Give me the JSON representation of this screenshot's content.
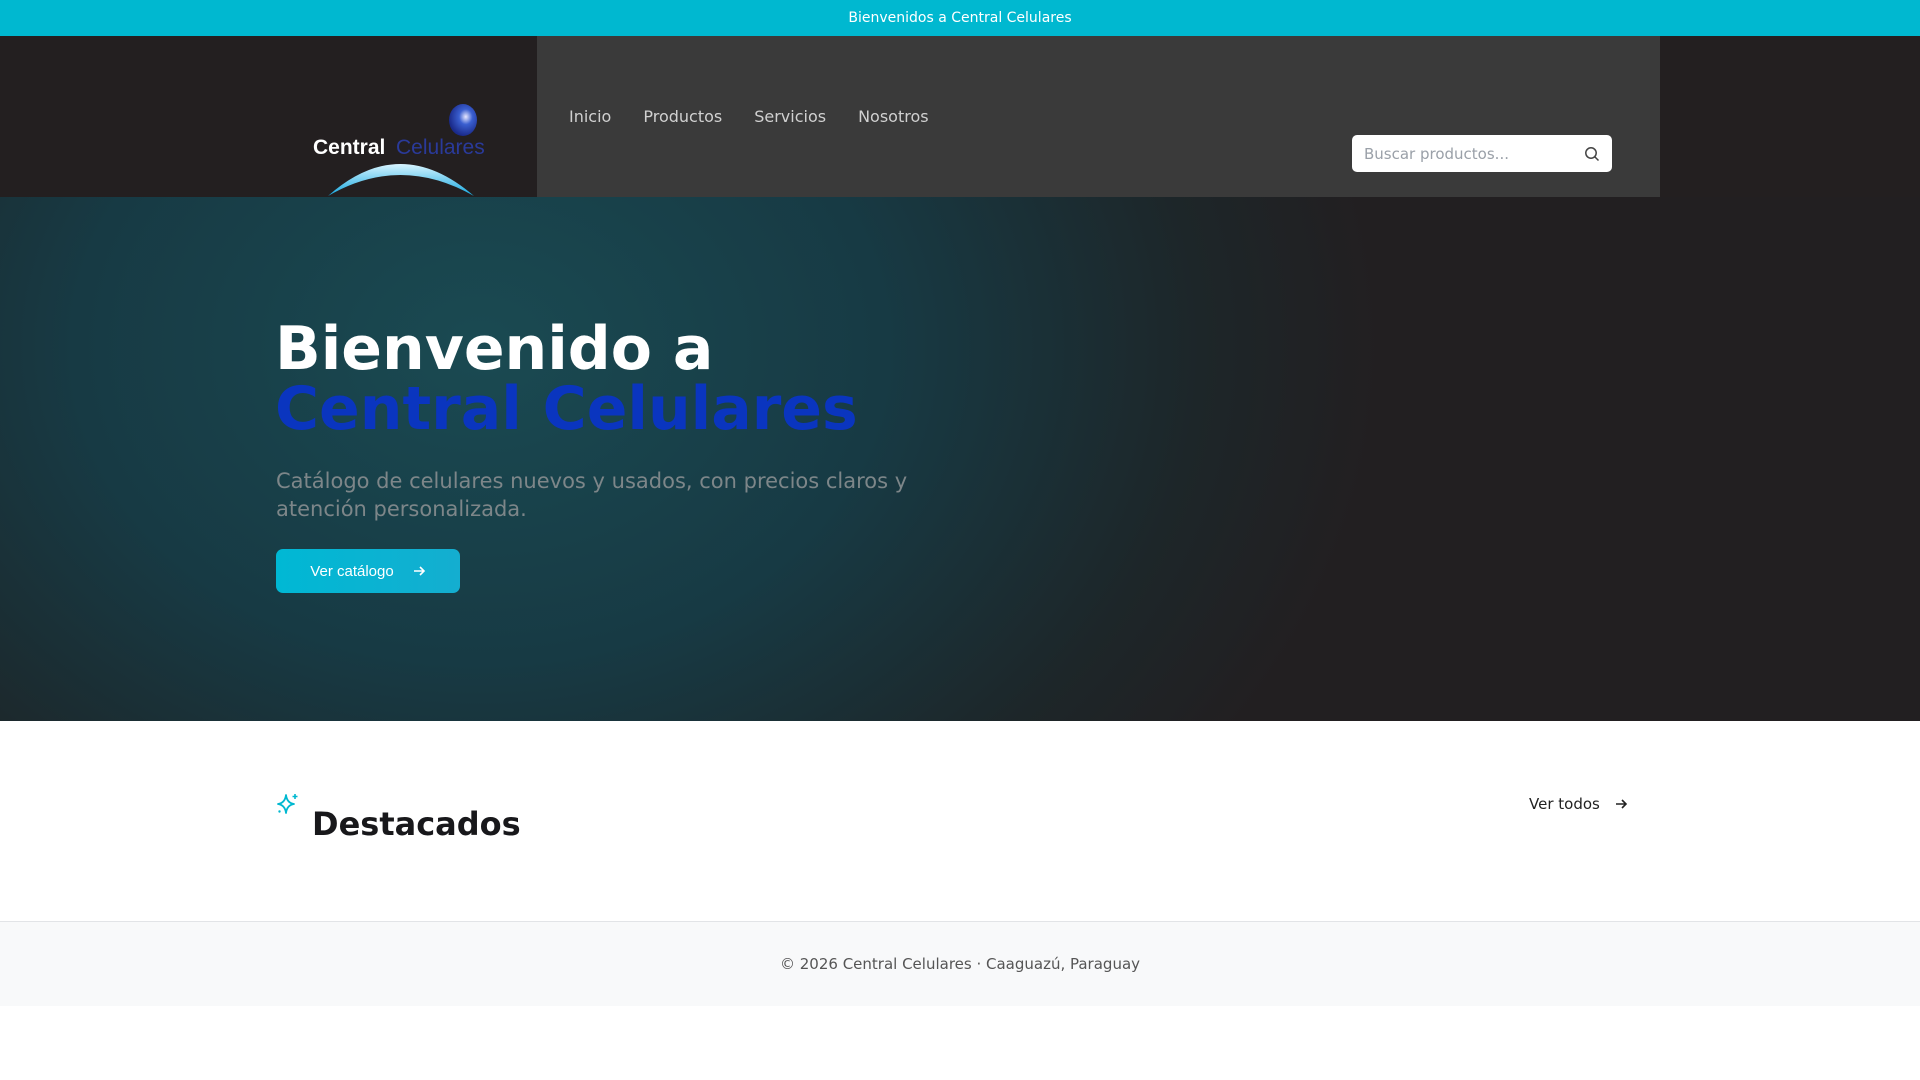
{
  "topbar": {
    "message": "Bienvenidos a Central Celulares"
  },
  "header": {
    "logo": {
      "text_white": "Central",
      "text_blue": "Celulares"
    },
    "nav": [
      {
        "label": "Inicio"
      },
      {
        "label": "Productos"
      },
      {
        "label": "Servicios"
      },
      {
        "label": "Nosotros"
      }
    ],
    "search": {
      "placeholder": "Buscar productos...",
      "value": "",
      "icon": "search-icon"
    }
  },
  "hero": {
    "title_line1": "Bienvenido a",
    "title_line2": "Central Celulares",
    "subtitle": "Catálogo de celulares nuevos y usados, con precios claros y atención personalizada.",
    "cta_label": "Ver catálogo"
  },
  "featured": {
    "title": "Destacados",
    "view_all": "Ver todos"
  },
  "footer": {
    "text": "© 2026 Central Celulares · Caaguazú, Paraguay"
  },
  "colors": {
    "accent": "#00b8d0",
    "brand_blue": "#0a35bf"
  }
}
